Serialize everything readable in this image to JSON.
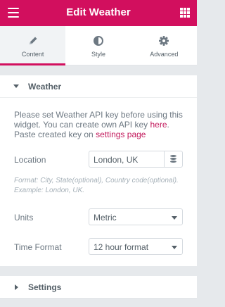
{
  "header": {
    "title": "Edit Weather",
    "menu_icon": "hamburger-icon",
    "apps_icon": "grid-icon",
    "color": "#d20f5e"
  },
  "tabs": [
    {
      "label": "Content",
      "icon": "pencil-icon",
      "active": true
    },
    {
      "label": "Style",
      "icon": "half-circle-icon",
      "active": false
    },
    {
      "label": "Advanced",
      "icon": "gear-icon",
      "active": false
    }
  ],
  "weather_section": {
    "title": "Weather",
    "notice_part1": "Please set Weather API key before using this widget. You can create own API key ",
    "notice_link1": "here",
    "notice_part2": ". Paste created key on ",
    "notice_link2": "settings page",
    "location": {
      "label": "Location",
      "value": "London, UK"
    },
    "hint": "Format: City, State(optional), Country code(optional). Example: London, UK.",
    "units": {
      "label": "Units",
      "value": "Metric"
    },
    "time_format": {
      "label": "Time Format",
      "value": "12 hour format"
    }
  },
  "settings_section": {
    "title": "Settings"
  }
}
